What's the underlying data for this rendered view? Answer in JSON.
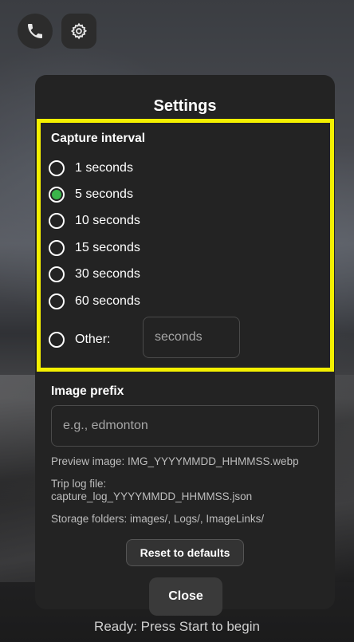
{
  "dialog": {
    "title": "Settings",
    "capture_interval": {
      "label": "Capture interval",
      "options": [
        {
          "label": "1 seconds",
          "selected": false
        },
        {
          "label": "5 seconds",
          "selected": true
        },
        {
          "label": "10 seconds",
          "selected": false
        },
        {
          "label": "15 seconds",
          "selected": false
        },
        {
          "label": "30 seconds",
          "selected": false
        },
        {
          "label": "60 seconds",
          "selected": false
        }
      ],
      "other_label": "Other:",
      "other_placeholder": "seconds",
      "other_value": ""
    },
    "image_prefix": {
      "label": "Image prefix",
      "placeholder": "e.g., edmonton",
      "value": ""
    },
    "info": {
      "preview": "Preview image: IMG_YYYYMMDD_HHMMSS.webp",
      "trip_log_label": "Trip log file:",
      "trip_log_file": "capture_log_YYYYMMDD_HHMMSS.json",
      "storage": "Storage folders: images/, Logs/, ImageLinks/"
    },
    "reset_label": "Reset to defaults"
  },
  "close_label": "Close",
  "status_text": "Ready: Press Start to begin",
  "colors": {
    "highlight": "#f4f000",
    "selected_radio": "#3ab54a",
    "dialog_bg": "#232323"
  },
  "icons": {
    "top_left": "phone-icon",
    "top_second": "gear-icon"
  }
}
